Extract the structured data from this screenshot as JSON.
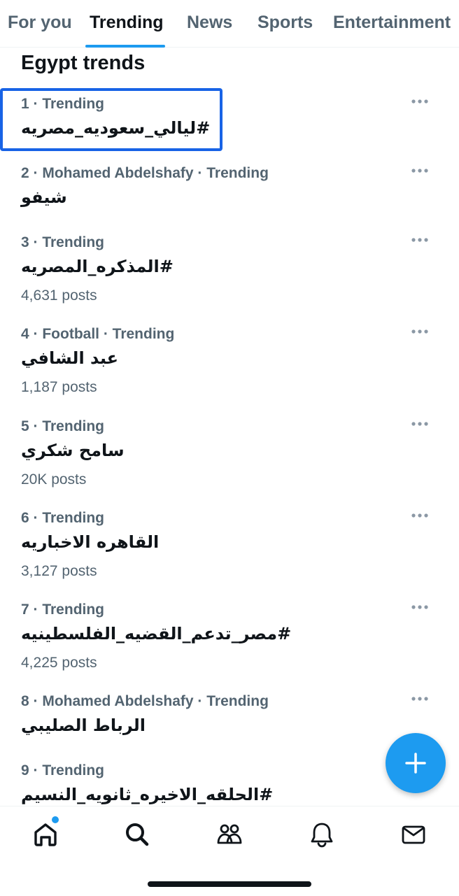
{
  "tabs": [
    {
      "label": "For you"
    },
    {
      "label": "Trending"
    },
    {
      "label": "News"
    },
    {
      "label": "Sports"
    },
    {
      "label": "Entertainment"
    }
  ],
  "active_tab": "Trending",
  "heading": "Egypt trends",
  "trends": [
    {
      "meta": "1 · Trending",
      "name": "#ليالي_سعوديه_مصريه",
      "posts": ""
    },
    {
      "meta": "2 · Mohamed Abdelshafy · Trending",
      "name": "شيفو",
      "posts": ""
    },
    {
      "meta": "3 · Trending",
      "name": "#المذكره_المصريه",
      "posts": "4,631 posts"
    },
    {
      "meta": "4 · Football · Trending",
      "name": "عبد الشافي",
      "posts": "1,187 posts"
    },
    {
      "meta": "5 · Trending",
      "name": "سامح شكري",
      "posts": "20K posts"
    },
    {
      "meta": "6 · Trending",
      "name": "القاهره الاخباريه",
      "posts": "3,127 posts"
    },
    {
      "meta": "7 · Trending",
      "name": "#مصر_تدعم_القضيه_الفلسطينيه",
      "posts": "4,225 posts"
    },
    {
      "meta": "8 · Mohamed Abdelshafy · Trending",
      "name": "الرباط الصليبي",
      "posts": ""
    },
    {
      "meta": "9 · Trending",
      "name": "#الحلقه_الاخيره_ثانويه_النسيم",
      "posts": ""
    }
  ],
  "icons": {
    "more": "more-horizontal-icon",
    "fab": "plus-icon",
    "nav": [
      "home-icon",
      "search-icon",
      "communities-icon",
      "notifications-icon",
      "messages-icon"
    ]
  },
  "colors": {
    "accent": "#1d9bf0",
    "highlight_box": "#1863e6",
    "secondary_text": "#536471",
    "primary_text": "#0f1419"
  }
}
